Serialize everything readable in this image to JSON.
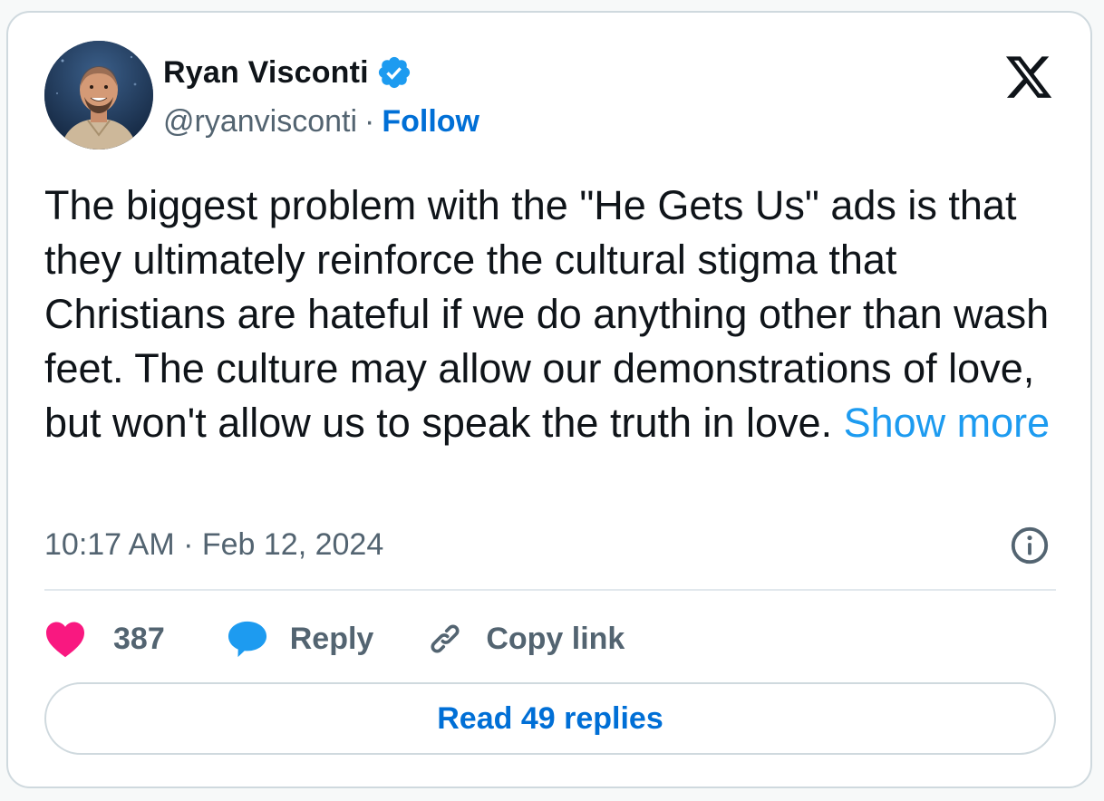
{
  "author": {
    "display_name": "Ryan Visconti",
    "handle": "@ryanvisconti",
    "separator": "·",
    "follow_label": "Follow",
    "verified": true,
    "avatar_icon": "profile-photo"
  },
  "brand_logo": "x-logo",
  "tweet": {
    "text": "The biggest problem with the \"He Gets Us\" ads is that they ultimately reinforce the cultural stigma that Christians are hateful if we do anything other than wash feet. The culture may allow our demonstrations of love, but won't allow us to speak the truth in love. ",
    "show_more_label": "Show more",
    "timestamp": "10:17 AM · Feb 12, 2024"
  },
  "actions": {
    "like_count": "387",
    "reply_label": "Reply",
    "copy_link_label": "Copy link"
  },
  "read_replies_label": "Read 49 replies",
  "colors": {
    "accent_link": "#006fd6",
    "show_more": "#1d9bf0",
    "like_heart": "#f91880",
    "reply_bubble": "#1d9bf0",
    "verified_badge": "#1d9bf0",
    "secondary_text": "#536471"
  }
}
